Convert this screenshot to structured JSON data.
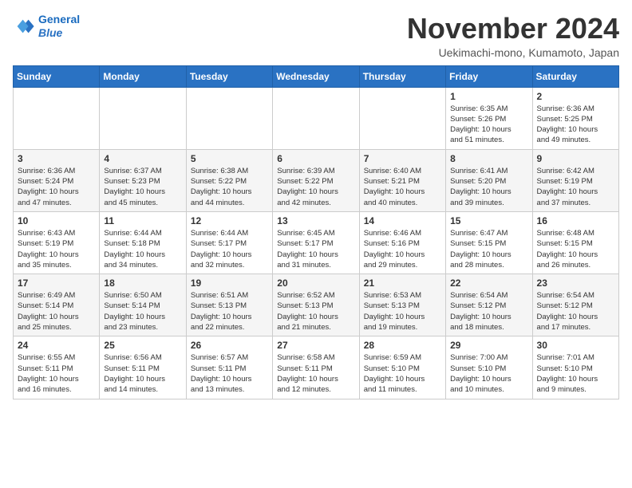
{
  "header": {
    "logo_line1": "General",
    "logo_line2": "Blue",
    "month": "November 2024",
    "location": "Uekimachi-mono, Kumamoto, Japan"
  },
  "days_of_week": [
    "Sunday",
    "Monday",
    "Tuesday",
    "Wednesday",
    "Thursday",
    "Friday",
    "Saturday"
  ],
  "weeks": [
    [
      {
        "day": "",
        "info": ""
      },
      {
        "day": "",
        "info": ""
      },
      {
        "day": "",
        "info": ""
      },
      {
        "day": "",
        "info": ""
      },
      {
        "day": "",
        "info": ""
      },
      {
        "day": "1",
        "info": "Sunrise: 6:35 AM\nSunset: 5:26 PM\nDaylight: 10 hours\nand 51 minutes."
      },
      {
        "day": "2",
        "info": "Sunrise: 6:36 AM\nSunset: 5:25 PM\nDaylight: 10 hours\nand 49 minutes."
      }
    ],
    [
      {
        "day": "3",
        "info": "Sunrise: 6:36 AM\nSunset: 5:24 PM\nDaylight: 10 hours\nand 47 minutes."
      },
      {
        "day": "4",
        "info": "Sunrise: 6:37 AM\nSunset: 5:23 PM\nDaylight: 10 hours\nand 45 minutes."
      },
      {
        "day": "5",
        "info": "Sunrise: 6:38 AM\nSunset: 5:22 PM\nDaylight: 10 hours\nand 44 minutes."
      },
      {
        "day": "6",
        "info": "Sunrise: 6:39 AM\nSunset: 5:22 PM\nDaylight: 10 hours\nand 42 minutes."
      },
      {
        "day": "7",
        "info": "Sunrise: 6:40 AM\nSunset: 5:21 PM\nDaylight: 10 hours\nand 40 minutes."
      },
      {
        "day": "8",
        "info": "Sunrise: 6:41 AM\nSunset: 5:20 PM\nDaylight: 10 hours\nand 39 minutes."
      },
      {
        "day": "9",
        "info": "Sunrise: 6:42 AM\nSunset: 5:19 PM\nDaylight: 10 hours\nand 37 minutes."
      }
    ],
    [
      {
        "day": "10",
        "info": "Sunrise: 6:43 AM\nSunset: 5:19 PM\nDaylight: 10 hours\nand 35 minutes."
      },
      {
        "day": "11",
        "info": "Sunrise: 6:44 AM\nSunset: 5:18 PM\nDaylight: 10 hours\nand 34 minutes."
      },
      {
        "day": "12",
        "info": "Sunrise: 6:44 AM\nSunset: 5:17 PM\nDaylight: 10 hours\nand 32 minutes."
      },
      {
        "day": "13",
        "info": "Sunrise: 6:45 AM\nSunset: 5:17 PM\nDaylight: 10 hours\nand 31 minutes."
      },
      {
        "day": "14",
        "info": "Sunrise: 6:46 AM\nSunset: 5:16 PM\nDaylight: 10 hours\nand 29 minutes."
      },
      {
        "day": "15",
        "info": "Sunrise: 6:47 AM\nSunset: 5:15 PM\nDaylight: 10 hours\nand 28 minutes."
      },
      {
        "day": "16",
        "info": "Sunrise: 6:48 AM\nSunset: 5:15 PM\nDaylight: 10 hours\nand 26 minutes."
      }
    ],
    [
      {
        "day": "17",
        "info": "Sunrise: 6:49 AM\nSunset: 5:14 PM\nDaylight: 10 hours\nand 25 minutes."
      },
      {
        "day": "18",
        "info": "Sunrise: 6:50 AM\nSunset: 5:14 PM\nDaylight: 10 hours\nand 23 minutes."
      },
      {
        "day": "19",
        "info": "Sunrise: 6:51 AM\nSunset: 5:13 PM\nDaylight: 10 hours\nand 22 minutes."
      },
      {
        "day": "20",
        "info": "Sunrise: 6:52 AM\nSunset: 5:13 PM\nDaylight: 10 hours\nand 21 minutes."
      },
      {
        "day": "21",
        "info": "Sunrise: 6:53 AM\nSunset: 5:13 PM\nDaylight: 10 hours\nand 19 minutes."
      },
      {
        "day": "22",
        "info": "Sunrise: 6:54 AM\nSunset: 5:12 PM\nDaylight: 10 hours\nand 18 minutes."
      },
      {
        "day": "23",
        "info": "Sunrise: 6:54 AM\nSunset: 5:12 PM\nDaylight: 10 hours\nand 17 minutes."
      }
    ],
    [
      {
        "day": "24",
        "info": "Sunrise: 6:55 AM\nSunset: 5:11 PM\nDaylight: 10 hours\nand 16 minutes."
      },
      {
        "day": "25",
        "info": "Sunrise: 6:56 AM\nSunset: 5:11 PM\nDaylight: 10 hours\nand 14 minutes."
      },
      {
        "day": "26",
        "info": "Sunrise: 6:57 AM\nSunset: 5:11 PM\nDaylight: 10 hours\nand 13 minutes."
      },
      {
        "day": "27",
        "info": "Sunrise: 6:58 AM\nSunset: 5:11 PM\nDaylight: 10 hours\nand 12 minutes."
      },
      {
        "day": "28",
        "info": "Sunrise: 6:59 AM\nSunset: 5:10 PM\nDaylight: 10 hours\nand 11 minutes."
      },
      {
        "day": "29",
        "info": "Sunrise: 7:00 AM\nSunset: 5:10 PM\nDaylight: 10 hours\nand 10 minutes."
      },
      {
        "day": "30",
        "info": "Sunrise: 7:01 AM\nSunset: 5:10 PM\nDaylight: 10 hours\nand 9 minutes."
      }
    ]
  ]
}
